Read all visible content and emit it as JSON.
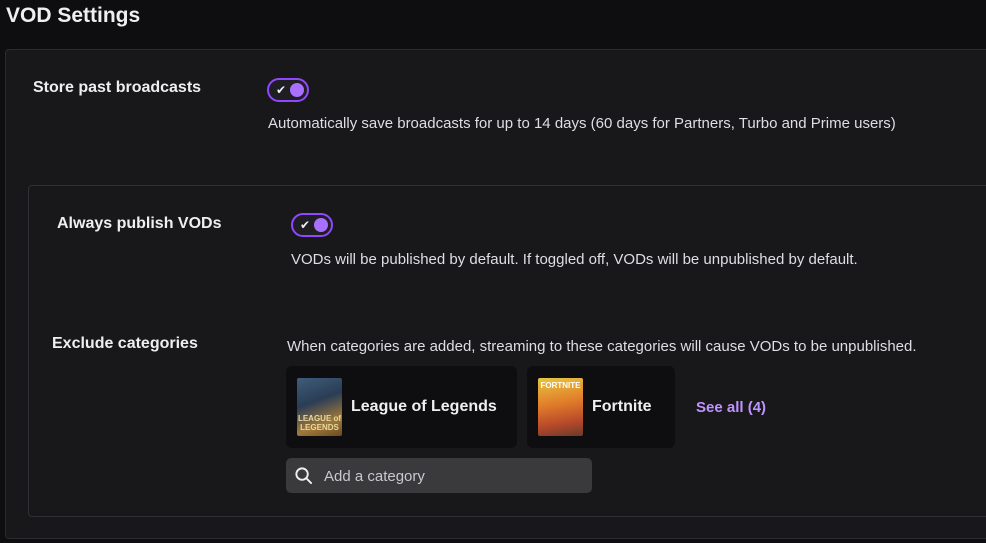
{
  "page": {
    "title": "VOD Settings"
  },
  "store_past": {
    "label": "Store past broadcasts",
    "enabled": true,
    "description": "Automatically save broadcasts for up to 14 days (60 days for Partners, Turbo and Prime users)"
  },
  "always_publish": {
    "label": "Always publish VODs",
    "enabled": true,
    "description": "VODs will be published by default. If toggled off, VODs will be unpublished by default."
  },
  "exclude": {
    "label": "Exclude categories",
    "description": "When categories are added, streaming to these categories will cause VODs to be unpublished.",
    "categories": [
      {
        "name": "League of Legends",
        "art_text": "LEAGUE of LEGENDS"
      },
      {
        "name": "Fortnite",
        "art_text": "FORTNITE"
      }
    ],
    "see_all": "See all (4)",
    "search_placeholder": "Add a category"
  },
  "icons": {
    "toggle_check": "check-icon",
    "search": "search-icon"
  },
  "colors": {
    "accent": "#9147ff",
    "link": "#bf94ff",
    "background": "#0e0e10",
    "panel": "#18181b"
  }
}
